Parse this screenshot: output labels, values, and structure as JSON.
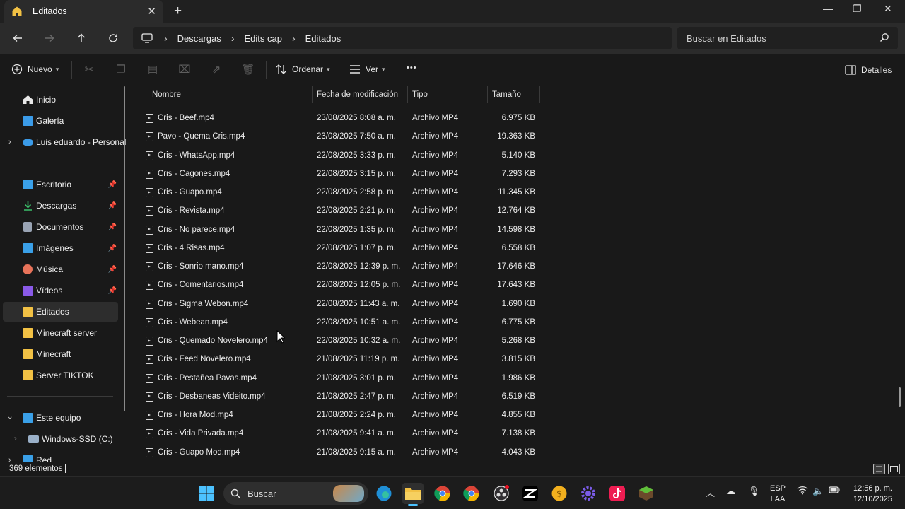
{
  "window": {
    "tab_title": "Editados",
    "close_tab": "✕",
    "new_tab": "+",
    "minimize": "—",
    "restore": "❐",
    "close": "✕"
  },
  "nav": {
    "breadcrumb": [
      "Descargas",
      "Edits cap",
      "Editados"
    ],
    "search_placeholder": "Buscar en Editados"
  },
  "toolbar": {
    "new_label": "Nuevo",
    "sort_label": "Ordenar",
    "view_label": "Ver",
    "more_label": "•••",
    "details_label": "Detalles"
  },
  "sidebar": {
    "items": [
      {
        "label": "Inicio",
        "icon": "home-icon",
        "color": "#e8e8e8"
      },
      {
        "label": "Galería",
        "icon": "gallery-icon",
        "color": "#3b9be8"
      },
      {
        "label": "Luis eduardo - Personal",
        "icon": "onedrive-icon",
        "color": "#3b9be8"
      },
      {
        "label": "Escritorio",
        "icon": "desktop-icon",
        "color": "#3aa0e8"
      },
      {
        "label": "Descargas",
        "icon": "download-icon",
        "color": "#3bbf6a"
      },
      {
        "label": "Documentos",
        "icon": "documents-icon",
        "color": "#9aa4b4"
      },
      {
        "label": "Imágenes",
        "icon": "pictures-icon",
        "color": "#3aa0e8"
      },
      {
        "label": "Música",
        "icon": "music-icon",
        "color": "#e8735a"
      },
      {
        "label": "Vídeos",
        "icon": "videos-icon",
        "color": "#8a5ae8"
      },
      {
        "label": "Editados",
        "icon": "folder-icon",
        "color": "#f2c144"
      },
      {
        "label": "Minecraft server",
        "icon": "folder-icon",
        "color": "#f2c144"
      },
      {
        "label": "Minecraft",
        "icon": "folder-icon",
        "color": "#f2c144"
      },
      {
        "label": "Server TIKTOK",
        "icon": "folder-icon",
        "color": "#f2c144"
      },
      {
        "label": "Este equipo",
        "icon": "computer-icon",
        "color": "#3aa0e8"
      },
      {
        "label": "Windows-SSD (C:)",
        "icon": "drive-icon",
        "color": "#9ab0c8"
      },
      {
        "label": "Red",
        "icon": "network-icon",
        "color": "#3aa0e8"
      }
    ]
  },
  "columns": {
    "name": "Nombre",
    "date": "Fecha de modificación",
    "type": "Tipo",
    "size": "Tamaño"
  },
  "files": [
    {
      "name": "Cris - Beef.mp4",
      "date": "23/08/2025 8:08 a. m.",
      "type": "Archivo MP4",
      "size": "6.975 KB"
    },
    {
      "name": "Pavo - Quema Cris.mp4",
      "date": "23/08/2025 7:50 a. m.",
      "type": "Archivo MP4",
      "size": "19.363 KB"
    },
    {
      "name": "Cris - WhatsApp.mp4",
      "date": "22/08/2025 3:33 p. m.",
      "type": "Archivo MP4",
      "size": "5.140 KB"
    },
    {
      "name": "Cris - Cagones.mp4",
      "date": "22/08/2025 3:15 p. m.",
      "type": "Archivo MP4",
      "size": "7.293 KB"
    },
    {
      "name": "Cris - Guapo.mp4",
      "date": "22/08/2025 2:58 p. m.",
      "type": "Archivo MP4",
      "size": "11.345 KB"
    },
    {
      "name": "Cris - Revista.mp4",
      "date": "22/08/2025 2:21 p. m.",
      "type": "Archivo MP4",
      "size": "12.764 KB"
    },
    {
      "name": "Cris - No parece.mp4",
      "date": "22/08/2025 1:35 p. m.",
      "type": "Archivo MP4",
      "size": "14.598 KB"
    },
    {
      "name": "Cris - 4 Risas.mp4",
      "date": "22/08/2025 1:07 p. m.",
      "type": "Archivo MP4",
      "size": "6.558 KB"
    },
    {
      "name": "Cris - Sonrio mano.mp4",
      "date": "22/08/2025 12:39 p. m.",
      "type": "Archivo MP4",
      "size": "17.646 KB"
    },
    {
      "name": "Cris - Comentarios.mp4",
      "date": "22/08/2025 12:05 p. m.",
      "type": "Archivo MP4",
      "size": "17.643 KB"
    },
    {
      "name": "Cris - Sigma Webon.mp4",
      "date": "22/08/2025 11:43 a. m.",
      "type": "Archivo MP4",
      "size": "1.690 KB"
    },
    {
      "name": "Cris - Webean.mp4",
      "date": "22/08/2025 10:51 a. m.",
      "type": "Archivo MP4",
      "size": "6.775 KB"
    },
    {
      "name": "Cris - Quemado Novelero.mp4",
      "date": "22/08/2025 10:32 a. m.",
      "type": "Archivo MP4",
      "size": "5.268 KB"
    },
    {
      "name": "Cris - Feed Novelero.mp4",
      "date": "21/08/2025 11:19 p. m.",
      "type": "Archivo MP4",
      "size": "3.815 KB"
    },
    {
      "name": "Cris - Pestañea Pavas.mp4",
      "date": "21/08/2025 3:01 p. m.",
      "type": "Archivo MP4",
      "size": "1.986 KB"
    },
    {
      "name": "Cris - Desbaneas Videito.mp4",
      "date": "21/08/2025 2:47 p. m.",
      "type": "Archivo MP4",
      "size": "6.519 KB"
    },
    {
      "name": "Cris - Hora Mod.mp4",
      "date": "21/08/2025 2:24 p. m.",
      "type": "Archivo MP4",
      "size": "4.855 KB"
    },
    {
      "name": "Cris - Vida Privada.mp4",
      "date": "21/08/2025 9:41 a. m.",
      "type": "Archivo MP4",
      "size": "7.138 KB"
    },
    {
      "name": "Cris - Guapo Mod.mp4",
      "date": "21/08/2025 9:15 a. m.",
      "type": "Archivo MP4",
      "size": "4.043 KB"
    }
  ],
  "status": {
    "count": "369 elementos"
  },
  "taskbar": {
    "search_placeholder": "Buscar",
    "lang_top": "ESP",
    "lang_bottom": "LAA",
    "time": "12:56 p. m.",
    "date": "12/10/2025"
  }
}
